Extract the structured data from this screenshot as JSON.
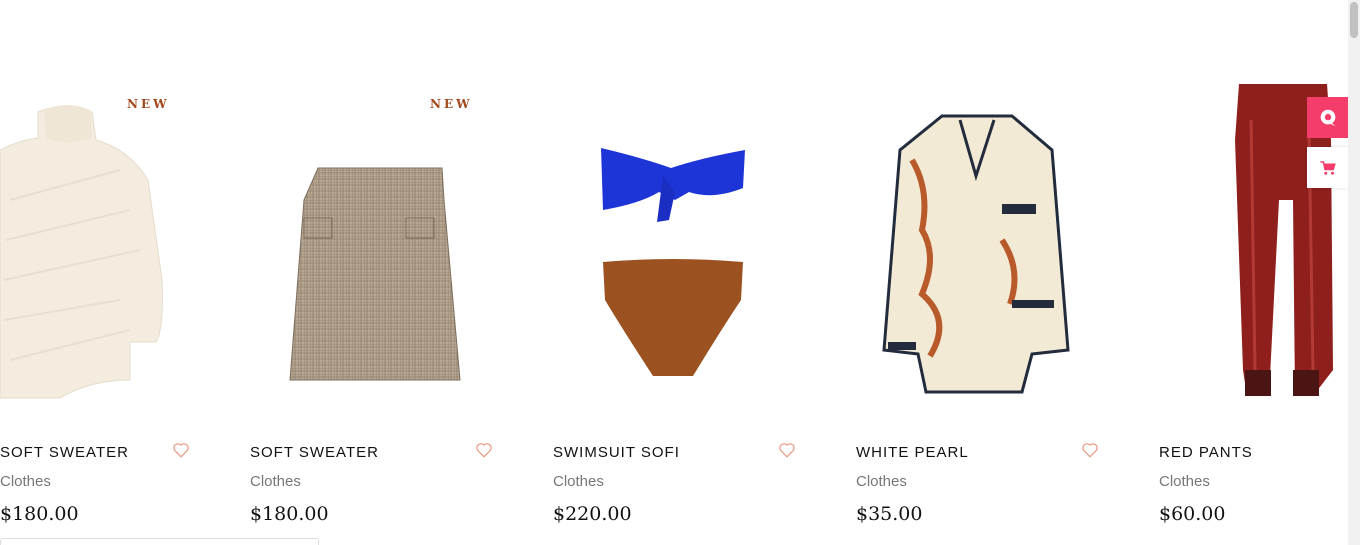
{
  "products": [
    {
      "name": "SOFT SWEATER",
      "category": "Clothes",
      "price": "$180.00",
      "badge": "NEW"
    },
    {
      "name": "SOFT SWEATER",
      "category": "Clothes",
      "price": "$180.00",
      "badge": "NEW"
    },
    {
      "name": "SWIMSUIT SOFI",
      "category": "Clothes",
      "price": "$220.00",
      "badge": ""
    },
    {
      "name": "WHITE PEARL",
      "category": "Clothes",
      "price": "$35.00",
      "badge": ""
    },
    {
      "name": "RED PANTS",
      "category": "Clothes",
      "price": "$60.00",
      "badge": ""
    }
  ],
  "side_buttons": {
    "top_icon": "chat-bubble-icon",
    "bottom_icon": "cart-icon"
  },
  "colors": {
    "accent": "#f43d6a",
    "badge": "#a24a1e",
    "heart": "#e8957a"
  }
}
